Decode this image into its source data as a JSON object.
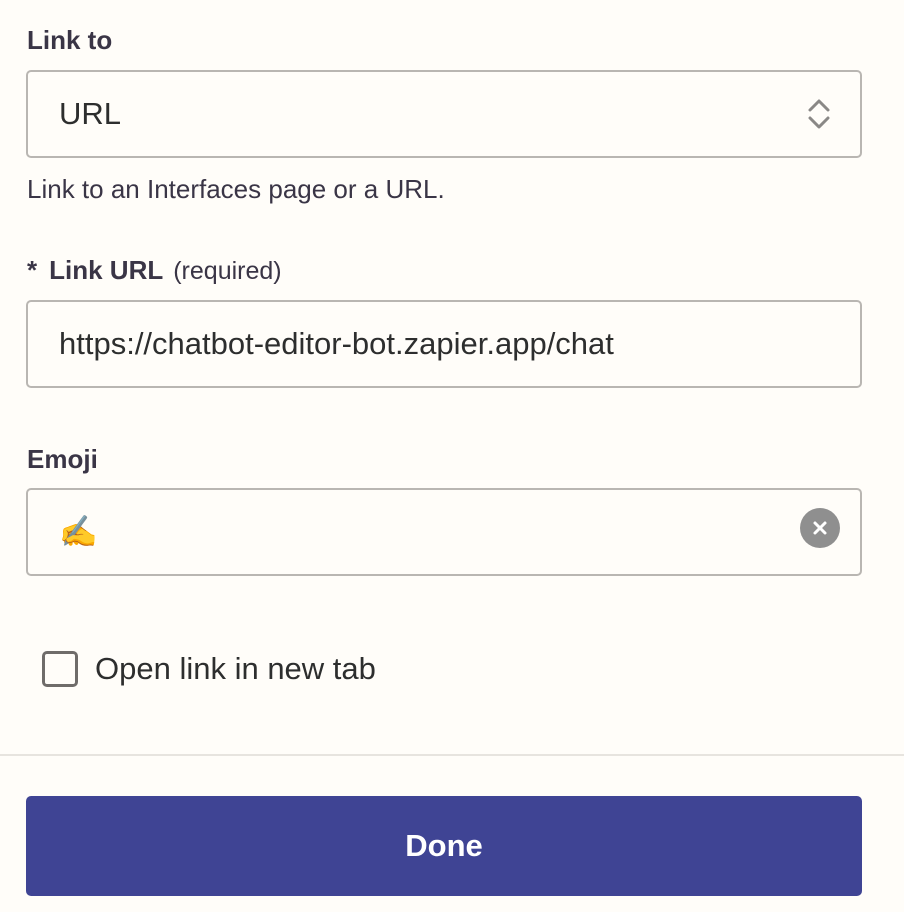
{
  "link_to": {
    "label": "Link to",
    "selected_value": "URL",
    "helper_text": "Link to an Interfaces page or a URL."
  },
  "link_url": {
    "required_star": "*",
    "label": "Link URL",
    "required_note": "(required)",
    "value": "https://chatbot-editor-bot.zapier.app/chat"
  },
  "emoji": {
    "label": "Emoji",
    "value": "✍️"
  },
  "open_in_new_tab": {
    "label": "Open link in new tab",
    "checked": false
  },
  "footer": {
    "done_label": "Done"
  },
  "colors": {
    "primary_button": "#3f4494",
    "background": "#fffdf9",
    "border": "#b9b6b2"
  }
}
